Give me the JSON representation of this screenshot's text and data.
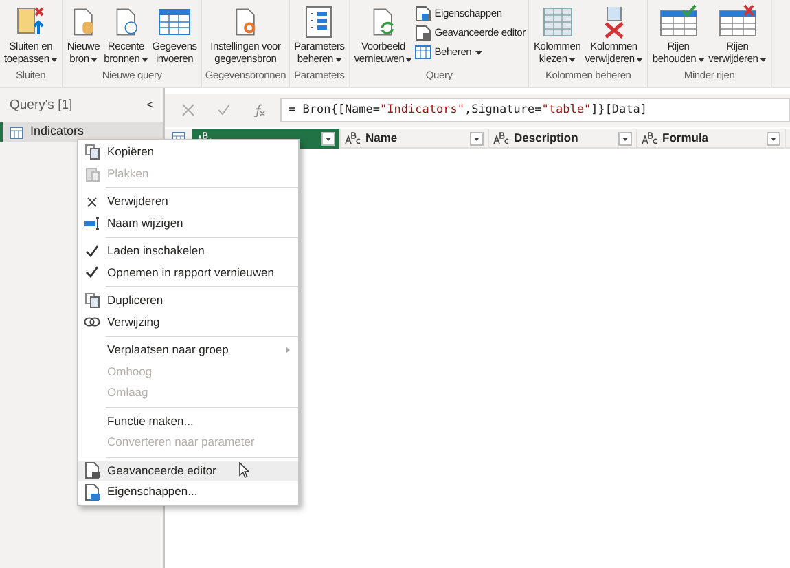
{
  "ribbon": {
    "groups": [
      {
        "label": "Sluiten",
        "buttons": [
          {
            "kind": "large",
            "lines": [
              "Sluiten en",
              "toepassen"
            ],
            "dropdown": true
          }
        ]
      },
      {
        "label": "Nieuwe query",
        "buttons": [
          {
            "kind": "large",
            "lines": [
              "Nieuwe",
              "bron"
            ],
            "dropdown": true
          },
          {
            "kind": "large",
            "lines": [
              "Recente",
              "bronnen"
            ],
            "dropdown": true
          },
          {
            "kind": "large",
            "lines": [
              "Gegevens",
              "invoeren"
            ],
            "dropdown": false
          }
        ]
      },
      {
        "label": "Gegevensbronnen",
        "buttons": [
          {
            "kind": "large",
            "lines": [
              "Instellingen voor",
              "gegevensbron"
            ],
            "dropdown": false
          }
        ]
      },
      {
        "label": "Parameters",
        "buttons": [
          {
            "kind": "large",
            "lines": [
              "Parameters",
              "beheren"
            ],
            "dropdown": true
          }
        ]
      },
      {
        "label": "Query",
        "buttons": [
          {
            "kind": "large",
            "lines": [
              "Voorbeeld",
              "vernieuwen"
            ],
            "dropdown": true
          },
          {
            "kind": "small",
            "lines": [
              "Eigenschappen"
            ],
            "dropdown": false
          },
          {
            "kind": "small",
            "lines": [
              "Geavanceerde editor"
            ],
            "dropdown": false
          },
          {
            "kind": "small",
            "lines": [
              "Beheren"
            ],
            "dropdown": true
          }
        ]
      },
      {
        "label": "Kolommen beheren",
        "buttons": [
          {
            "kind": "large",
            "lines": [
              "Kolommen",
              "kiezen"
            ],
            "dropdown": true
          },
          {
            "kind": "large",
            "lines": [
              "Kolommen",
              "verwijderen"
            ],
            "dropdown": true
          }
        ]
      },
      {
        "label": "Minder rijen",
        "buttons": [
          {
            "kind": "large",
            "lines": [
              "Rijen",
              "behouden"
            ],
            "dropdown": true
          },
          {
            "kind": "large",
            "lines": [
              "Rijen",
              "verwijderen"
            ],
            "dropdown": true
          }
        ]
      }
    ]
  },
  "queries_pane": {
    "title": "Query's [1]",
    "collapse": "<",
    "items": [
      {
        "label": "Indicators",
        "selected": true
      }
    ]
  },
  "formula_bar": {
    "segments": [
      {
        "kind": "plain",
        "text": "= Bron{[Name="
      },
      {
        "kind": "string",
        "text": "\"Indicators\""
      },
      {
        "kind": "plain",
        "text": ",Signature="
      },
      {
        "kind": "string",
        "text": "\"table\""
      },
      {
        "kind": "plain",
        "text": "]}[Data]"
      }
    ]
  },
  "columns": [
    {
      "selected": true
    },
    {
      "label": "Name",
      "selected": false
    },
    {
      "label": "Description",
      "selected": false
    },
    {
      "label": "Formula",
      "selected": false
    }
  ],
  "context_menu": {
    "sections": [
      [
        {
          "label": "Kopiëren",
          "disabled": false,
          "selected": false,
          "checked": false
        },
        {
          "label": "Plakken",
          "disabled": true,
          "selected": false,
          "checked": false
        }
      ],
      [
        {
          "label": "Verwijderen",
          "disabled": false,
          "selected": false,
          "checked": false
        },
        {
          "label": "Naam wijzigen",
          "disabled": false,
          "selected": false,
          "checked": false
        }
      ],
      [
        {
          "label": "Laden inschakelen",
          "disabled": false,
          "selected": false,
          "checked": true
        },
        {
          "label": "Opnemen in rapport vernieuwen",
          "disabled": false,
          "selected": false,
          "checked": true
        }
      ],
      [
        {
          "label": "Dupliceren",
          "disabled": false,
          "selected": false,
          "checked": false
        },
        {
          "label": "Verwijzing",
          "disabled": false,
          "selected": false,
          "checked": false
        }
      ],
      [
        {
          "label": "Verplaatsen naar groep",
          "disabled": false,
          "selected": false,
          "checked": false,
          "submenu": true
        },
        {
          "label": "Omhoog",
          "disabled": true,
          "selected": false,
          "checked": false
        },
        {
          "label": "Omlaag",
          "disabled": true,
          "selected": false,
          "checked": false
        }
      ],
      [
        {
          "label": "Functie maken...",
          "disabled": false,
          "selected": false,
          "checked": false
        },
        {
          "label": "Converteren naar parameter",
          "disabled": true,
          "selected": false,
          "checked": false
        }
      ],
      [
        {
          "label": "Geavanceerde editor",
          "disabled": false,
          "selected": true,
          "checked": false
        },
        {
          "label": "Eigenschappen...",
          "disabled": false,
          "selected": false,
          "checked": false
        }
      ]
    ]
  }
}
